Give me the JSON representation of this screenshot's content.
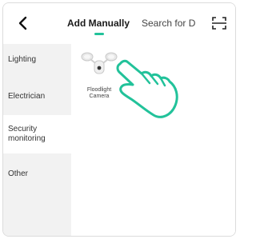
{
  "header": {
    "tab_add_manually": "Add Manually",
    "tab_search": "Search for D"
  },
  "sidebar": {
    "items": [
      {
        "label": "Lighting"
      },
      {
        "label": "Electrician"
      },
      {
        "label": "Security\nmonitoring"
      },
      {
        "label": "Other"
      }
    ],
    "active_index": 2
  },
  "content": {
    "devices": [
      {
        "label_line1": "Floodlight",
        "label_line2": "Camera",
        "icon": "floodlight-camera-icon"
      }
    ]
  },
  "overlay": {
    "icon": "pointing-hand-icon"
  },
  "colors": {
    "accent": "#22c29a",
    "sidebar_bg": "#f2f2f2",
    "active_bg": "#ffffff"
  }
}
